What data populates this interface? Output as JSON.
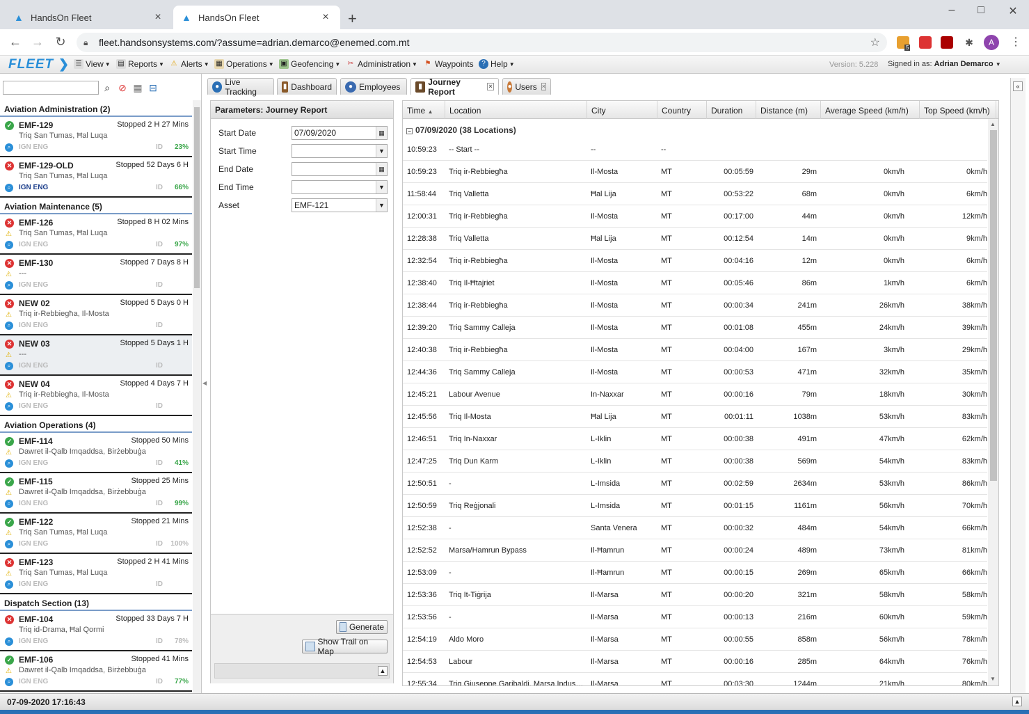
{
  "browser": {
    "tabs": [
      {
        "title": "HandsOn Fleet",
        "active": false
      },
      {
        "title": "HandsOn Fleet",
        "active": true
      }
    ],
    "url": "fleet.handsonsystems.com/?assume=adrian.demarco@enemed.com.mt",
    "profile_initial": "A",
    "extension_badge": "5"
  },
  "app": {
    "logo": "FLEET",
    "menu": [
      "View",
      "Reports",
      "Alerts",
      "Operations",
      "Geofencing",
      "Administration",
      "Waypoints",
      "Help"
    ],
    "version": "Version: 5.228",
    "signed_in_label": "Signed in as:",
    "signed_in_user": "Adrian Demarco"
  },
  "tabs": [
    "Live Tracking",
    "Dashboard",
    "Employees",
    "Journey Report",
    "Users"
  ],
  "active_tab": "Journey Report",
  "left_panel": {
    "search_value": "",
    "groups": [
      {
        "title": "Aviation Administration (2)",
        "assets": [
          {
            "name": "EMF-129",
            "status": "ok",
            "state": "Stopped 2 H 27 Mins",
            "address": "Triq San Tumas, Ħal Luqa",
            "ign_on": false,
            "id": "ID",
            "pct": "23%",
            "warn": false
          },
          {
            "name": "EMF-129-OLD",
            "status": "bad",
            "state": "Stopped 52 Days 6 H",
            "address": "Triq San Tumas, Ħal Luqa",
            "ign_on": true,
            "id": "ID",
            "pct": "66%",
            "warn": false
          }
        ]
      },
      {
        "title": "Aviation Maintenance (5)",
        "assets": [
          {
            "name": "EMF-126",
            "status": "bad",
            "state": "Stopped 8 H 02 Mins",
            "address": "Triq San Tumas, Ħal Luqa",
            "ign_on": false,
            "id": "ID",
            "pct": "97%",
            "warn": true
          },
          {
            "name": "EMF-130",
            "status": "bad",
            "state": "Stopped 7 Days 8 H",
            "address": "---",
            "ign_on": false,
            "id": "ID",
            "pct": "",
            "warn": true
          },
          {
            "name": "NEW 02",
            "status": "bad",
            "state": "Stopped 5 Days 0 H",
            "address": "Triq ir-Rebbiegħa, Il-Mosta",
            "ign_on": false,
            "id": "ID",
            "pct": "",
            "warn": true
          },
          {
            "name": "NEW 03",
            "status": "bad",
            "state": "Stopped 5 Days 1 H",
            "address": "---",
            "ign_on": false,
            "id": "ID",
            "pct": "",
            "warn": true,
            "selected": true
          },
          {
            "name": "NEW 04",
            "status": "bad",
            "state": "Stopped 4 Days 7 H",
            "address": "Triq ir-Rebbiegħa, Il-Mosta",
            "ign_on": false,
            "id": "ID",
            "pct": "",
            "warn": true
          }
        ]
      },
      {
        "title": "Aviation Operations (4)",
        "assets": [
          {
            "name": "EMF-114",
            "status": "ok",
            "state": "Stopped 50 Mins",
            "address": "Dawret il-Qalb Imqaddsa, Birżebbuġa",
            "ign_on": false,
            "id": "ID",
            "pct": "41%",
            "warn": true
          },
          {
            "name": "EMF-115",
            "status": "ok",
            "state": "Stopped 25 Mins",
            "address": "Dawret il-Qalb Imqaddsa, Birżebbuġa",
            "ign_on": false,
            "id": "ID",
            "pct": "99%",
            "warn": true
          },
          {
            "name": "EMF-122",
            "status": "ok",
            "state": "Stopped 21 Mins",
            "address": "Triq San Tumas, Ħal Luqa",
            "ign_on": false,
            "id": "ID",
            "pct": "100%",
            "warn": true,
            "pct_dim": true
          },
          {
            "name": "EMF-123",
            "status": "bad",
            "state": "Stopped 2 H 41 Mins",
            "address": "Triq San Tumas, Ħal Luqa",
            "ign_on": false,
            "id": "ID",
            "pct": "",
            "warn": true
          }
        ]
      },
      {
        "title": "Dispatch Section (13)",
        "assets": [
          {
            "name": "EMF-104",
            "status": "bad",
            "state": "Stopped 33 Days 7 H",
            "address": "Triq id-Drama, Ħal Qormi",
            "ign_on": false,
            "id": "ID",
            "pct": "78%",
            "warn": false,
            "pct_dim": true
          },
          {
            "name": "EMF-106",
            "status": "ok",
            "state": "Stopped 41 Mins",
            "address": "Dawret il-Qalb Imqaddsa, Birżebbuġa",
            "ign_on": false,
            "id": "ID",
            "pct": "77%",
            "warn": true
          }
        ]
      }
    ]
  },
  "params": {
    "title": "Parameters: Journey Report",
    "start_date_label": "Start Date",
    "start_date": "07/09/2020",
    "start_time_label": "Start Time",
    "start_time": "",
    "end_date_label": "End Date",
    "end_date": "",
    "end_time_label": "End Time",
    "end_time": "",
    "asset_label": "Asset",
    "asset": "EMF-121",
    "generate": "Generate",
    "show_trail": "Show Trail on Map"
  },
  "grid": {
    "columns": [
      "Time",
      "Location",
      "City",
      "Country",
      "Duration",
      "Distance (m)",
      "Average Speed (km/h)",
      "Top Speed (km/h)"
    ],
    "group_label": "07/09/2020 (38 Locations)",
    "rows": [
      [
        "10:59:23",
        "-- Start --",
        "--",
        "--",
        "",
        "",
        "",
        ""
      ],
      [
        "10:59:23",
        "Triq ir-Rebbiegħa",
        "Il-Mosta",
        "MT",
        "00:05:59",
        "29m",
        "0km/h",
        "0km/h"
      ],
      [
        "11:58:44",
        "Triq Valletta",
        "Ħal Lija",
        "MT",
        "00:53:22",
        "68m",
        "0km/h",
        "6km/h"
      ],
      [
        "12:00:31",
        "Triq ir-Rebbiegħa",
        "Il-Mosta",
        "MT",
        "00:17:00",
        "44m",
        "0km/h",
        "12km/h"
      ],
      [
        "12:28:38",
        "Triq Valletta",
        "Ħal Lija",
        "MT",
        "00:12:54",
        "14m",
        "0km/h",
        "9km/h"
      ],
      [
        "12:32:54",
        "Triq ir-Rebbiegħa",
        "Il-Mosta",
        "MT",
        "00:04:16",
        "12m",
        "0km/h",
        "6km/h"
      ],
      [
        "12:38:40",
        "Triq Il-Ħtajriet",
        "Il-Mosta",
        "MT",
        "00:05:46",
        "86m",
        "1km/h",
        "6km/h"
      ],
      [
        "12:38:44",
        "Triq ir-Rebbiegħa",
        "Il-Mosta",
        "MT",
        "00:00:34",
        "241m",
        "26km/h",
        "38km/h"
      ],
      [
        "12:39:20",
        "Triq Sammy Calleja",
        "Il-Mosta",
        "MT",
        "00:01:08",
        "455m",
        "24km/h",
        "39km/h"
      ],
      [
        "12:40:38",
        "Triq ir-Rebbiegħa",
        "Il-Mosta",
        "MT",
        "00:04:00",
        "167m",
        "3km/h",
        "29km/h"
      ],
      [
        "12:44:36",
        "Triq Sammy Calleja",
        "Il-Mosta",
        "MT",
        "00:00:53",
        "471m",
        "32km/h",
        "35km/h"
      ],
      [
        "12:45:21",
        "Labour Avenue",
        "In-Naxxar",
        "MT",
        "00:00:16",
        "79m",
        "18km/h",
        "30km/h"
      ],
      [
        "12:45:56",
        "Triq Il-Mosta",
        "Ħal Lija",
        "MT",
        "00:01:11",
        "1038m",
        "53km/h",
        "83km/h"
      ],
      [
        "12:46:51",
        "Triq In-Naxxar",
        "L-Iklin",
        "MT",
        "00:00:38",
        "491m",
        "47km/h",
        "62km/h"
      ],
      [
        "12:47:25",
        "Triq Dun Karm",
        "L-Iklin",
        "MT",
        "00:00:38",
        "569m",
        "54km/h",
        "83km/h"
      ],
      [
        "12:50:51",
        "-",
        "L-Imsida",
        "MT",
        "00:02:59",
        "2634m",
        "53km/h",
        "86km/h"
      ],
      [
        "12:50:59",
        "Triq Reġjonali",
        "L-Imsida",
        "MT",
        "00:01:15",
        "1161m",
        "56km/h",
        "70km/h"
      ],
      [
        "12:52:38",
        "-",
        "Santa Venera",
        "MT",
        "00:00:32",
        "484m",
        "54km/h",
        "66km/h"
      ],
      [
        "12:52:52",
        "Marsa/Hamrun Bypass",
        "Il-Ħamrun",
        "MT",
        "00:00:24",
        "489m",
        "73km/h",
        "81km/h"
      ],
      [
        "12:53:09",
        "-",
        "Il-Ħamrun",
        "MT",
        "00:00:15",
        "269m",
        "65km/h",
        "66km/h"
      ],
      [
        "12:53:36",
        "Triq It-Tiġrija",
        "Il-Marsa",
        "MT",
        "00:00:20",
        "321m",
        "58km/h",
        "58km/h"
      ],
      [
        "12:53:56",
        "-",
        "Il-Marsa",
        "MT",
        "00:00:13",
        "216m",
        "60km/h",
        "59km/h"
      ],
      [
        "12:54:19",
        "Aldo Moro",
        "Il-Marsa",
        "MT",
        "00:00:55",
        "858m",
        "56km/h",
        "78km/h"
      ],
      [
        "12:54:53",
        "Labour",
        "Il-Marsa",
        "MT",
        "00:00:16",
        "285m",
        "64km/h",
        "76km/h"
      ],
      [
        "12:55:34",
        "Triq Giuseppe Garibaldi, Marsa Indus…",
        "Il-Marsa",
        "MT",
        "00:03:30",
        "1244m",
        "21km/h",
        "80km/h"
      ]
    ]
  },
  "status": {
    "datetime": "07-09-2020 17:16:43"
  }
}
